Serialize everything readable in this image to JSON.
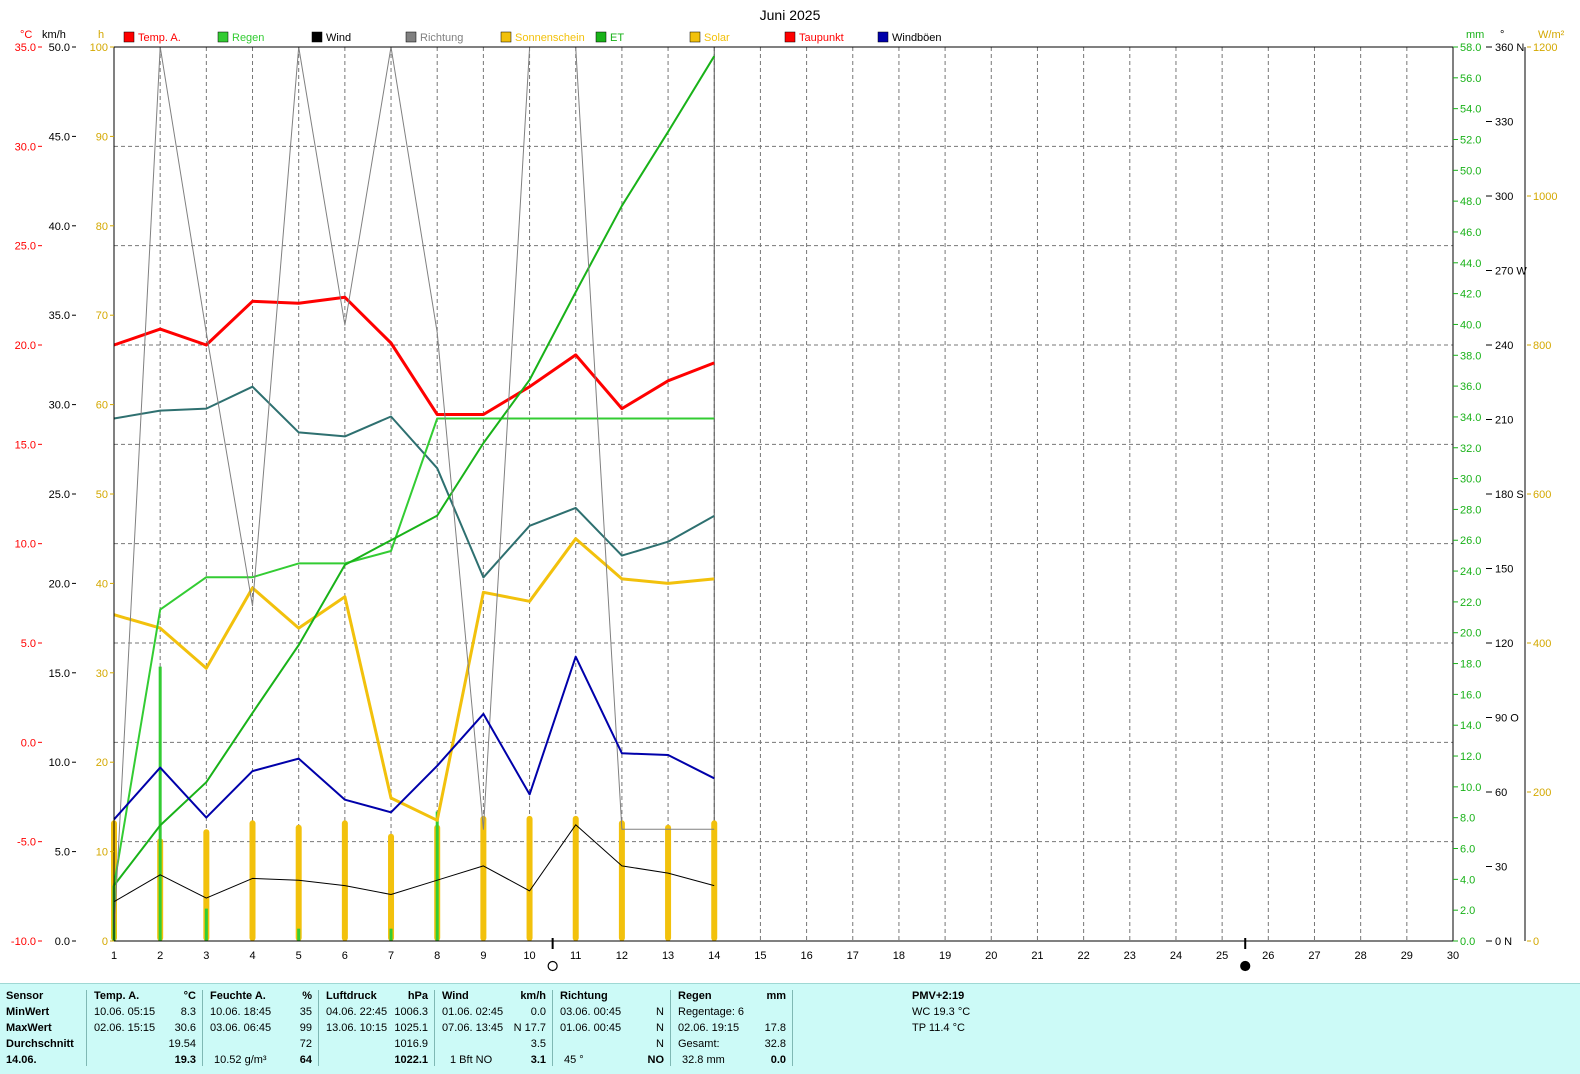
{
  "title": "Juni 2025",
  "axes_units": {
    "temp": "°C",
    "wind": "km/h",
    "hours": "h",
    "rain": "mm",
    "direction": "°",
    "solar": "W/m²"
  },
  "legend": [
    {
      "label": "Temp. A.",
      "color": "#ff0000",
      "text_color": "#ff0000"
    },
    {
      "label": "Regen",
      "color": "#33cc33",
      "text_color": "#33cc33"
    },
    {
      "label": "Wind",
      "color": "#000000",
      "text_color": "#000000"
    },
    {
      "label": "Richtung",
      "color": "#808080",
      "text_color": "#808080"
    },
    {
      "label": "Sonnenschein",
      "color": "#f2c10c",
      "text_color": "#f2c10c"
    },
    {
      "label": "ET",
      "color": "#19b219",
      "text_color": "#19b219"
    },
    {
      "label": "Solar",
      "color": "#f2c10c",
      "text_color": "#f2c10c"
    },
    {
      "label": "Taupunkt",
      "color": "#ff0000",
      "text_color": "#ff0000"
    },
    {
      "label": "Windböen",
      "color": "#0000aa",
      "text_color": "#000000"
    }
  ],
  "chart_data": {
    "type": "line",
    "title": "Juni 2025",
    "x": [
      1,
      2,
      3,
      4,
      5,
      6,
      7,
      8,
      9,
      10,
      11,
      12,
      13,
      14
    ],
    "x_range": [
      1,
      30
    ],
    "x_ticks": [
      "1",
      "2",
      "3",
      "4",
      "5",
      "6",
      "7",
      "8",
      "9",
      "10",
      "11",
      "12",
      "13",
      "14",
      "15",
      "16",
      "17",
      "18",
      "19",
      "20",
      "21",
      "22",
      "23",
      "24",
      "25",
      "26",
      "27",
      "28",
      "29",
      "30"
    ],
    "ticks": {
      "temp": [
        "35.0",
        "30.0",
        "25.0",
        "20.0",
        "15.0",
        "10.0",
        "5.0",
        "0.0",
        "-5.0",
        "-10.0"
      ],
      "wind": [
        "50.0",
        "45.0",
        "40.0",
        "35.0",
        "30.0",
        "25.0",
        "20.0",
        "15.0",
        "10.0",
        "5.0",
        "0.0"
      ],
      "hours": [
        "100",
        "90",
        "80",
        "70",
        "60",
        "50",
        "40",
        "30",
        "20",
        "10",
        "0"
      ],
      "rain": [
        "58.0",
        "56.0",
        "54.0",
        "52.0",
        "50.0",
        "48.0",
        "46.0",
        "44.0",
        "42.0",
        "40.0",
        "38.0",
        "36.0",
        "34.0",
        "32.0",
        "30.0",
        "28.0",
        "26.0",
        "24.0",
        "22.0",
        "20.0",
        "18.0",
        "16.0",
        "14.0",
        "12.0",
        "10.0",
        "8.0",
        "6.0",
        "4.0",
        "2.0",
        "0.0"
      ],
      "direction": [
        "360 N",
        "330",
        "300",
        "270 W",
        "240",
        "210",
        "180 S",
        "150",
        "120",
        "90 O",
        "60",
        "30",
        "0 N"
      ],
      "solar": [
        "1200",
        "1000",
        "800",
        "600",
        "400",
        "200",
        "0"
      ]
    },
    "ranges": {
      "temp": [
        -10,
        35
      ],
      "wind": [
        0,
        50
      ],
      "hours": [
        0,
        100
      ],
      "rain": [
        0,
        58
      ],
      "direction": [
        0,
        360
      ],
      "solar": [
        0,
        1200
      ]
    },
    "series": [
      {
        "name": "Temp. A.",
        "axis": "temp",
        "color": "#ff0000",
        "width": 3,
        "values": [
          20.0,
          20.8,
          20.0,
          22.2,
          22.1,
          22.4,
          20.1,
          16.5,
          16.5,
          17.9,
          19.5,
          16.8,
          18.2,
          19.1
        ]
      },
      {
        "name": "Taupunkt",
        "axis": "temp",
        "color": "#2e7070",
        "width": 2,
        "values": [
          16.3,
          16.7,
          16.8,
          17.9,
          15.6,
          15.4,
          16.4,
          13.8,
          8.3,
          10.9,
          11.8,
          9.4,
          10.1,
          11.4
        ]
      },
      {
        "name": "Sonnenschein",
        "axis": "hours",
        "color": "#f2c10c",
        "width": 3,
        "values": [
          36.5,
          35.0,
          30.5,
          39.5,
          35.0,
          38.5,
          16.0,
          13.5,
          39.0,
          38.0,
          45.0,
          40.5,
          40.0,
          40.5
        ]
      },
      {
        "name": "Regen",
        "axis": "rain",
        "color": "#33cc33",
        "width": 2,
        "values": [
          3.6,
          21.5,
          23.6,
          23.6,
          24.5,
          24.5,
          25.3,
          33.9,
          33.9,
          33.9,
          33.9,
          33.9,
          33.9,
          33.9
        ]
      },
      {
        "name": "ET",
        "axis": "rain",
        "color": "#19b219",
        "width": 2,
        "values": [
          3.6,
          7.5,
          10.3,
          14.8,
          19.2,
          24.4,
          26.0,
          27.6,
          32.3,
          36.4,
          42.1,
          47.7,
          52.5,
          57.4
        ]
      },
      {
        "name": "Richtung",
        "axis": "direction",
        "color": "#808080",
        "width": 1,
        "values": [
          3,
          360,
          245,
          135,
          360,
          248,
          360,
          245,
          45,
          360,
          360,
          45,
          45,
          45
        ]
      },
      {
        "name": "Windböen",
        "axis": "wind",
        "color": "#0000aa",
        "width": 2,
        "values": [
          6.8,
          9.7,
          6.9,
          9.5,
          10.2,
          7.9,
          7.2,
          9.8,
          12.7,
          8.2,
          15.9,
          10.5,
          10.4,
          9.1
        ]
      },
      {
        "name": "Wind",
        "axis": "wind",
        "color": "#000000",
        "width": 1,
        "values": [
          2.2,
          3.7,
          2.4,
          3.5,
          3.4,
          3.1,
          2.6,
          3.4,
          4.2,
          2.8,
          6.5,
          4.2,
          3.8,
          3.1
        ]
      }
    ],
    "bars": [
      {
        "name": "Sonnenschein",
        "axis": "hours",
        "color": "#f2c10c",
        "values": [
          13.5,
          11.5,
          12.5,
          13.5,
          13.0,
          13.5,
          12.0,
          13.0,
          14.0,
          14.0,
          14.0,
          13.5,
          13.0,
          13.5
        ]
      },
      {
        "name": "Regen",
        "axis": "rain",
        "color": "#33cc33",
        "values": [
          3.6,
          17.8,
          2.1,
          0.0,
          0.8,
          0.0,
          0.8,
          8.4,
          0.0,
          0.0,
          0.0,
          0.0,
          0.0,
          0.0
        ]
      }
    ],
    "moon_phases": [
      {
        "day": 10.5,
        "symbol": "full"
      },
      {
        "day": 25.5,
        "symbol": "new"
      }
    ],
    "grid": true
  },
  "stats": {
    "labels": {
      "sensor": "Sensor",
      "min": "MinWert",
      "max": "MaxWert",
      "avg": "Durchschnitt",
      "date": "14.06."
    },
    "temp": {
      "title": "Temp. A.",
      "unit": "°C",
      "min_time": "10.06.  05:15",
      "min_val": "8.3",
      "max_time": "02.06.  15:15",
      "max_val": "30.6",
      "avg": "19.54",
      "current": "19.3"
    },
    "humidity": {
      "title": "Feuchte A.",
      "unit": "%",
      "min_time": "10.06.  18:45",
      "min_val": "35",
      "max_time": "03.06.  06:45",
      "max_val": "99",
      "avg": "72",
      "current_extra": "10.52 g/m³",
      "current": "64"
    },
    "pressure": {
      "title": "Luftdruck",
      "unit": "hPa",
      "min_time": "04.06.  22:45",
      "min_val": "1006.3",
      "max_time": "13.06.  10:15",
      "max_val": "1025.1",
      "avg": "1016.9",
      "current": "1022.1"
    },
    "wind": {
      "title": "Wind",
      "unit": "km/h",
      "min_time": "01.06.  02:45",
      "min_val": "0.0",
      "max_time": "07.06.  13:45",
      "max_val": "N 17.7",
      "avg": "3.5",
      "current_extra": "1 Bft NO",
      "current": "3.1"
    },
    "direction": {
      "title": "Richtung",
      "min_time": "03.06.  00:45",
      "min_val": "N",
      "max_time": "01.06.  00:45",
      "max_val": "N",
      "avg": "N",
      "current_extra": "45 °",
      "current": "NO"
    },
    "rain": {
      "title": "Regen",
      "unit": "mm",
      "row1": "Regentage: 6",
      "row2_time": "02.06.  19:15",
      "row2_val": "17.8",
      "row3_label": "Gesamt:",
      "row3_val": "32.8",
      "current_extra": "32.8 mm",
      "current": "0.0"
    },
    "extra": {
      "pmv": "PMV+2:19",
      "wc": "WC 19.3 °C",
      "tp": "TP 11.4 °C"
    }
  }
}
